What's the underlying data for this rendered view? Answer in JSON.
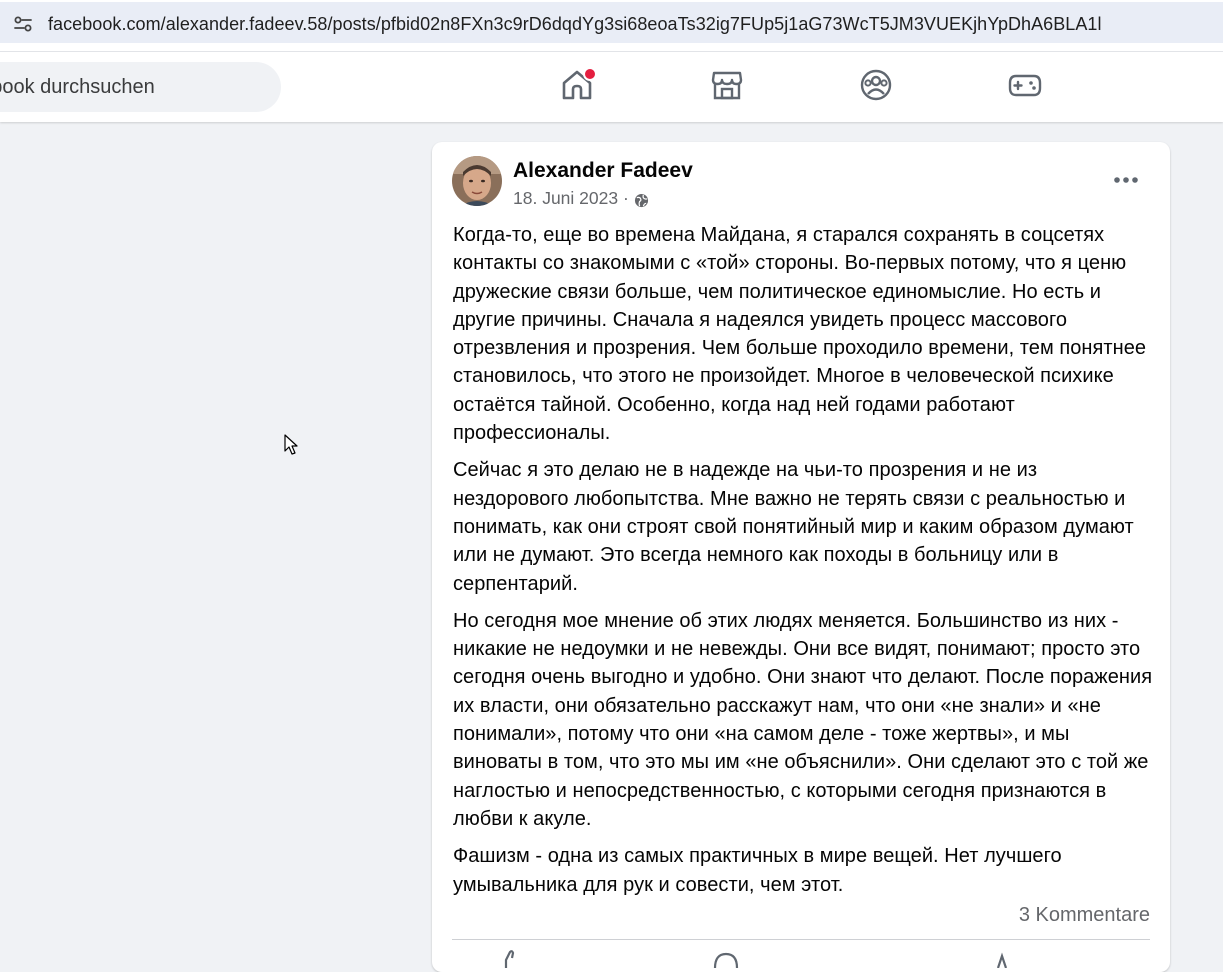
{
  "browser": {
    "url": "facebook.com/alexander.fadeev.58/posts/pfbid02n8FXn3c9rD6dqdYg3si68eoaTs32ig7FUp5j1aG73WcT5JM3VUEKjhYpDhA6BLA1l"
  },
  "nav": {
    "search_placeholder": "acebook durchsuchen",
    "icons": [
      "home-icon",
      "marketplace-icon",
      "groups-icon",
      "gaming-icon"
    ],
    "notification_color": "#e41e3f"
  },
  "post": {
    "author": "Alexander Fadeev",
    "date": "18. Juni 2023 ·",
    "audience_icon": "globe-icon",
    "paragraphs": [
      "Когда-то, еще во времена Майдана, я старался сохранять в соцсетях контакты со знакомыми с «той» стороны. Во-первых потому, что я ценю дружеские связи больше, чем политическое единомыслие. Но есть и другие причины. Сначала я надеялся увидеть процесс массового отрезвления и прозрения. Чем больше проходило времени, тем понятнее становилось, что этого не произойдет. Многое в человеческой психике остаётся тайной. Особенно, когда над ней годами работают профессионалы.",
      "Сейчас я это делаю не в надежде на чьи-то прозрения и не из нездорового любопытства. Мне важно не терять связи с реальностью и понимать, как они строят свой понятийный мир и каким образом думают или не думают. Это всегда немного как походы в больницу или в серпентарий.",
      "Но сегодня мое мнение об этих людях меняется. Большинство из них - никакие не недоумки и не невежды. Они все видят, понимают; просто это сегодня очень выгодно и удобно. Они знают что делают. После поражения их власти, они обязательно расскажут нам, что они «не знали» и «не понимали», потому что они «на самом деле - тоже жертвы», и мы виноваты в том, что это мы им «не объяснили». Они сделают это с той же наглостью и непосредственностью, с которыми сегодня признаются в любви к акуле.",
      "Фашизм - одна из самых практичных в мире вещей. Нет лучшего умывальника для рук и совести, чем этот."
    ],
    "comments": "3 Kommentare"
  }
}
